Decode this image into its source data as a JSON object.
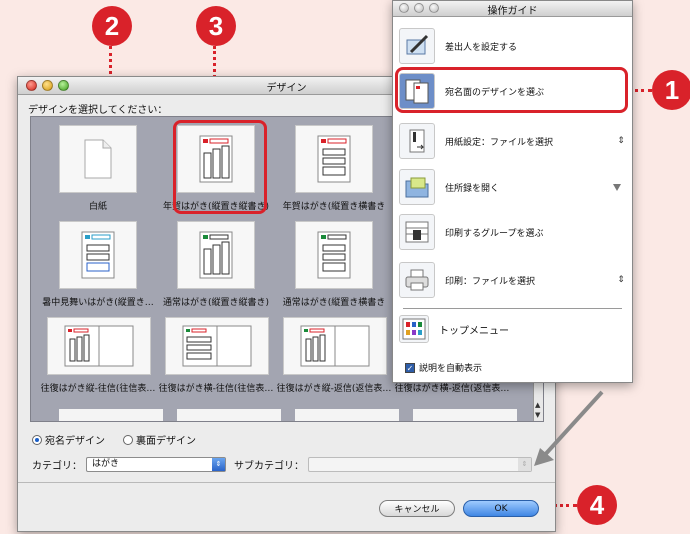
{
  "callouts": [
    "1",
    "2",
    "3",
    "4"
  ],
  "design_window": {
    "title": "デザイン",
    "prompt": "デザインを選択してください：",
    "designs": [
      "白紙",
      "年賀はがき(縦置き縦書き)",
      "年賀はがき(縦置き横書き",
      "暑中見舞いはがき(縦置き…",
      "通常はがき(縦置き縦書き)",
      "通常はがき(縦置き横書き",
      "往復はがき縦-往信(往信表…",
      "往復はがき横-往信(往信表…",
      "往復はがき縦-返信(返信表…",
      "往復はがき横-返信(返信表…"
    ],
    "radio": {
      "address_label": "宛名デザイン",
      "back_label": "裏面デザイン",
      "selected": "宛名デザイン"
    },
    "category": {
      "label": "カテゴリ：",
      "value": "はがき",
      "sub_label": "サブカテゴリ：",
      "sub_value": ""
    },
    "buttons": {
      "cancel": "キャンセル",
      "ok": "OK"
    }
  },
  "guide_window": {
    "title": "操作ガイド",
    "steps": [
      {
        "label": "差出人を設定する",
        "icon": "pen-card-icon"
      },
      {
        "label": "宛名面のデザインを選ぶ",
        "icon": "postcard-design-icon"
      },
      {
        "label": "用紙設定：ファイルを選択",
        "icon": "paper-setup-icon"
      },
      {
        "label": "住所録を開く",
        "icon": "folder-icon"
      },
      {
        "label": "印刷するグループを選ぶ",
        "icon": "group-icon"
      },
      {
        "label": "印刷：ファイルを選択",
        "icon": "printer-icon"
      }
    ],
    "top_menu": "トップメニュー",
    "auto_show": "説明を自動表示",
    "auto_show_checked": true
  },
  "colors": {
    "accent_red": "#d9222a",
    "selection_blue": "#6d8ec8",
    "ok_blue": "#3f86e3"
  }
}
